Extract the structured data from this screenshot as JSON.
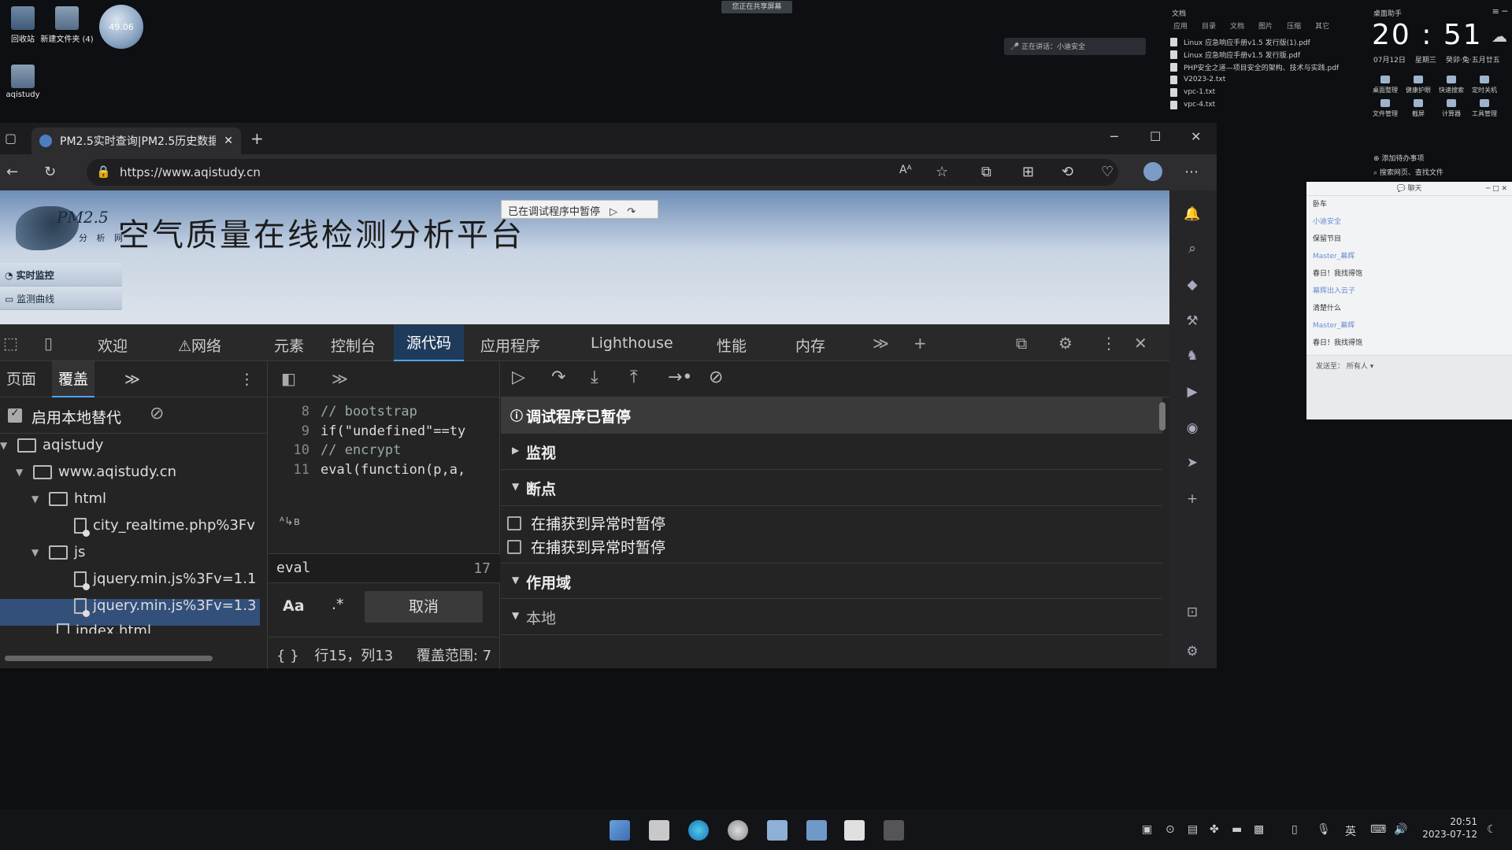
{
  "desktop": {
    "icons": [
      {
        "label": "回收站"
      },
      {
        "label": "新建文件夹 (4)"
      },
      {
        "label": "aqistudy"
      }
    ],
    "avatar_text": "49.06",
    "share_badge": "您正在共享屏幕",
    "voice_bar": "正在讲话：小迪安全"
  },
  "file_panel": {
    "title": "文档",
    "tabs": [
      "应用",
      "目录",
      "文档",
      "图片",
      "压缩",
      "其它"
    ],
    "files": [
      "Linux 应急响应手册v1.5 发行版(1).pdf",
      "Linux 应急响应手册v1.5 发行版.pdf",
      "PHP安全之道—项目安全的架构、技术与实践.pdf",
      "V2023-2.txt",
      "vpc-1.txt",
      "vpc-4.txt"
    ]
  },
  "clock_widget": {
    "title": "桌面助手",
    "time": "20 : 51",
    "date": "07月12日",
    "weekday": "星期三",
    "lunar": "癸卯·兔·五月廿五",
    "tools": [
      "桌面整理",
      "健康护眼",
      "快速搜索",
      "定时关机",
      "文件管理",
      "截屏",
      "计算器",
      "工具管理"
    ],
    "todo_label": "添加待办事项",
    "search_label": "搜索网页、查找文件"
  },
  "chat": {
    "title": "聊天",
    "messages": [
      {
        "text": "卧车",
        "blue": false
      },
      {
        "text": "小迪安全",
        "blue": true
      },
      {
        "text": "保留节目",
        "blue": false
      },
      {
        "text": "Master_幕辉",
        "blue": true
      },
      {
        "text": "春日！我找得饱",
        "blue": false
      },
      {
        "text": "幕辉出入云子",
        "blue": true
      },
      {
        "text": "清楚什么",
        "blue": false
      },
      {
        "text": "Master_幕辉",
        "blue": true
      },
      {
        "text": "春日！我找得饱",
        "blue": false
      }
    ],
    "send_to_label": "发送至：",
    "send_to_value": "所有人"
  },
  "browser": {
    "tab_title": "PM2.5实时查询|PM2.5历史数据查",
    "url": "https://www.aqistudy.cn",
    "reader_label": "Aᴬ"
  },
  "page": {
    "logo_text": "PM2.5",
    "logo_sub": "分 析 网",
    "site_title": "空气质量在线检测分析平台",
    "debug_paused": "已在调试程序中暂停",
    "nav": [
      "实时监控",
      "监测曲线"
    ]
  },
  "devtools": {
    "tabs": [
      "欢迎",
      "网络",
      "元素",
      "控制台",
      "源代码",
      "应用程序",
      "Lighthouse",
      "性能",
      "内存"
    ],
    "left_tabs": {
      "page": "页面",
      "overrides": "覆盖"
    },
    "enable_local_overrides": "启用本地替代",
    "tree": [
      {
        "label": "aqistudy",
        "type": "folder"
      },
      {
        "label": "www.aqistudy.cn",
        "type": "folder"
      },
      {
        "label": "html",
        "type": "folder"
      },
      {
        "label": "city_realtime.php%3Fv",
        "type": "file"
      },
      {
        "label": "js",
        "type": "folder"
      },
      {
        "label": "jquery.min.js%3Fv=1.1",
        "type": "file"
      },
      {
        "label": "jquery.min.js%3Fv=1.3",
        "type": "file"
      },
      {
        "label": "index.html",
        "type": "file"
      }
    ],
    "code_lines": [
      {
        "num": "8",
        "text": "// bootstrap"
      },
      {
        "num": "9",
        "text": "if(\"undefined\"==ty"
      },
      {
        "num": "10",
        "text": "// encrypt"
      },
      {
        "num": "11",
        "text": "eval(function(p,a,"
      }
    ],
    "search_value": "eval",
    "search_count": "17",
    "match_case": "Aa",
    "regex": ".*",
    "cancel": "取消",
    "status": "行15，列13",
    "coverage": "覆盖范围: 7",
    "paused": "调试程序已暂停",
    "watch": "监视",
    "breakpoints": "断点",
    "pause_caught_1": "在捕获到异常时暂停",
    "pause_caught_2": "在捕获到异常时暂停",
    "scope": "作用域",
    "local": "本地"
  },
  "taskbar": {
    "ime": "英",
    "time": "20:51",
    "date": "2023-07-12"
  }
}
